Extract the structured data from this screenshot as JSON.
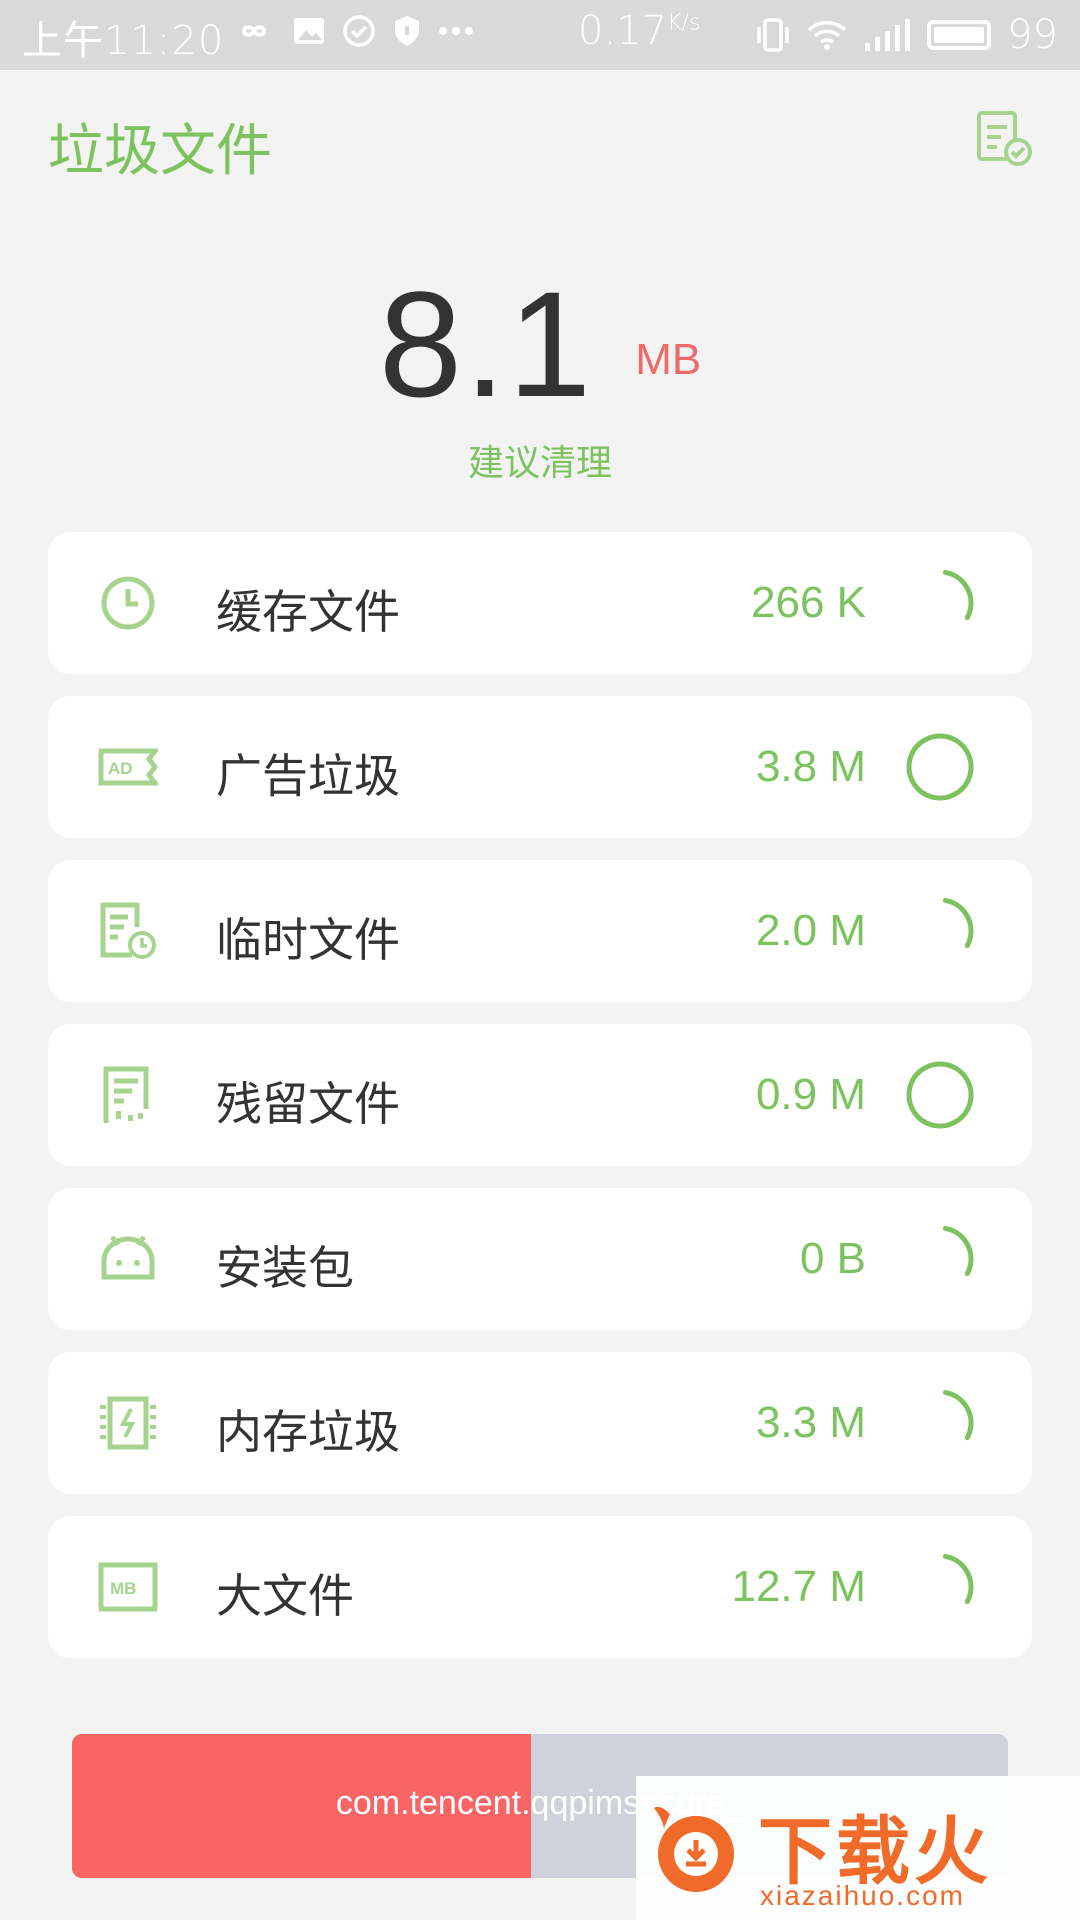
{
  "status_bar": {
    "time": "上午11:20",
    "speed": "0.17",
    "speed_unit": "K/s",
    "battery": "99",
    "icons": [
      "infinity-icon",
      "image-icon",
      "check-circle-icon",
      "shield-icon",
      "more-dots-icon",
      "vibrate-icon",
      "wifi-icon",
      "signal-4g-icon",
      "battery-icon"
    ]
  },
  "header": {
    "title": "垃圾文件",
    "report_icon": "report-check-icon"
  },
  "summary": {
    "size_value": "8.1",
    "size_unit": "MB",
    "suggestion": "建议清理"
  },
  "items": [
    {
      "label": "缓存文件",
      "size": "266 K",
      "icon": "clock-icon",
      "progress": 0.3
    },
    {
      "label": "广告垃圾",
      "size": "3.8 M",
      "icon": "ad-ticket-icon",
      "progress": 1.0
    },
    {
      "label": "临时文件",
      "size": "2.0 M",
      "icon": "temp-file-icon",
      "progress": 0.3
    },
    {
      "label": "残留文件",
      "size": "0.9 M",
      "icon": "residual-file-icon",
      "progress": 1.0
    },
    {
      "label": "安装包",
      "size": "0 B",
      "icon": "android-icon",
      "progress": 0.3
    },
    {
      "label": "内存垃圾",
      "size": "3.3 M",
      "icon": "memory-icon",
      "progress": 0.3
    },
    {
      "label": "大文件",
      "size": "12.7 M",
      "icon": "mb-file-icon",
      "progress": 0.3
    }
  ],
  "scan": {
    "text": "com.tencent.qqpimsecure_",
    "progress": 0.49
  },
  "watermark": {
    "brand": "下载火",
    "url": "xiazaihuo.com"
  },
  "colors": {
    "accent_green": "#7cc35f",
    "unit_red": "#ee6b6b",
    "scan_fill": "#f96464",
    "scan_track": "#cfd2da"
  }
}
